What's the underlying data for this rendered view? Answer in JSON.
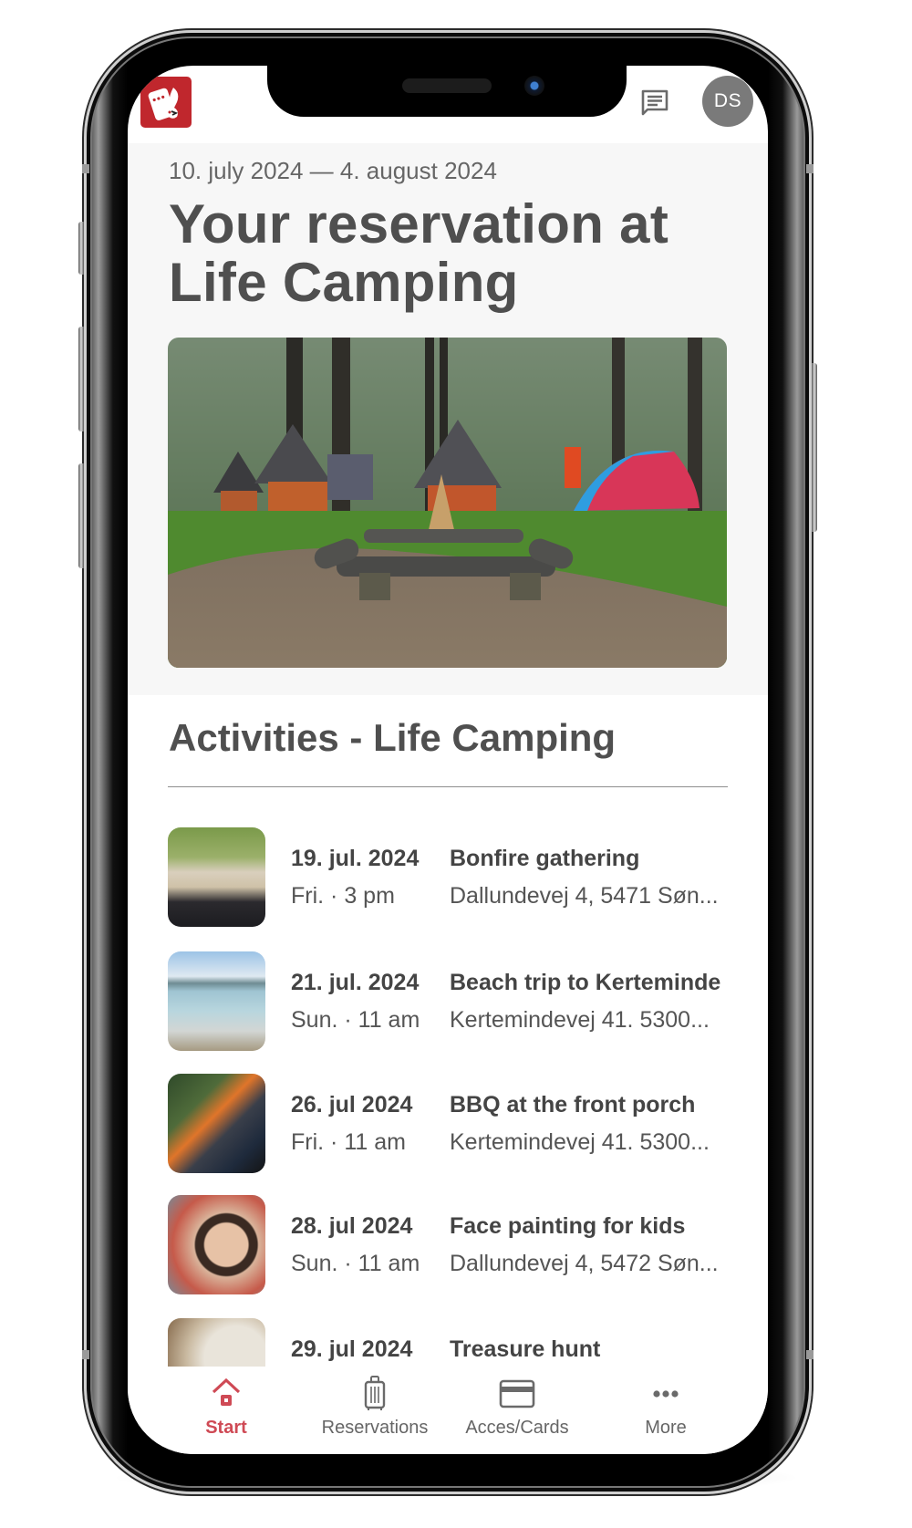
{
  "header": {
    "logo_icon": "camping-card-key-logo",
    "chat_icon": "message-icon",
    "avatar_initials": "DS"
  },
  "reservation": {
    "date_range": "10. july 2024 — 4. august 2024",
    "title": "Your reservation at Life Camping",
    "hero_image": "campsite-cabins-campfire-photo"
  },
  "activities": {
    "heading": "Activities - Life Camping",
    "items": [
      {
        "date": "19. jul. 2024",
        "day_time": "Fri.  · 3 pm",
        "title": "Bonfire gathering",
        "address": "Dallundevej 4, 5471 Søn...",
        "thumb": "bonfire-bread"
      },
      {
        "date": "21. jul. 2024",
        "day_time": "Sun. · 11 am",
        "title": "Beach trip to Kerteminde",
        "address": "Kertemindevej 41. 5300...",
        "thumb": "beach"
      },
      {
        "date": "26. jul 2024",
        "day_time": "Fri. · 11 am",
        "title": "BBQ at the front porch",
        "address": "Kertemindevej 41. 5300...",
        "thumb": "bbq"
      },
      {
        "date": "28. jul 2024",
        "day_time": "Sun. · 11 am",
        "title": "Face painting for kids",
        "address": "Dallundevej 4, 5472 Søn...",
        "thumb": "face-paint"
      },
      {
        "date": "29. jul 2024",
        "day_time": "",
        "title": "Treasure hunt",
        "address": "",
        "thumb": "treasure-map"
      }
    ]
  },
  "tabbar": {
    "active": "Start",
    "tabs": [
      {
        "label": "Start",
        "icon": "home-icon"
      },
      {
        "label": "Reservations",
        "icon": "luggage-icon"
      },
      {
        "label": "Acces/Cards",
        "icon": "card-icon"
      },
      {
        "label": "More",
        "icon": "more-dots-icon"
      }
    ]
  },
  "colors": {
    "accent": "#cf4a55",
    "logo_red": "#c0272d",
    "text_dark": "#4f4f4f",
    "band_bg": "#f7f7f7",
    "avatar_bg": "#7a7a7a"
  }
}
